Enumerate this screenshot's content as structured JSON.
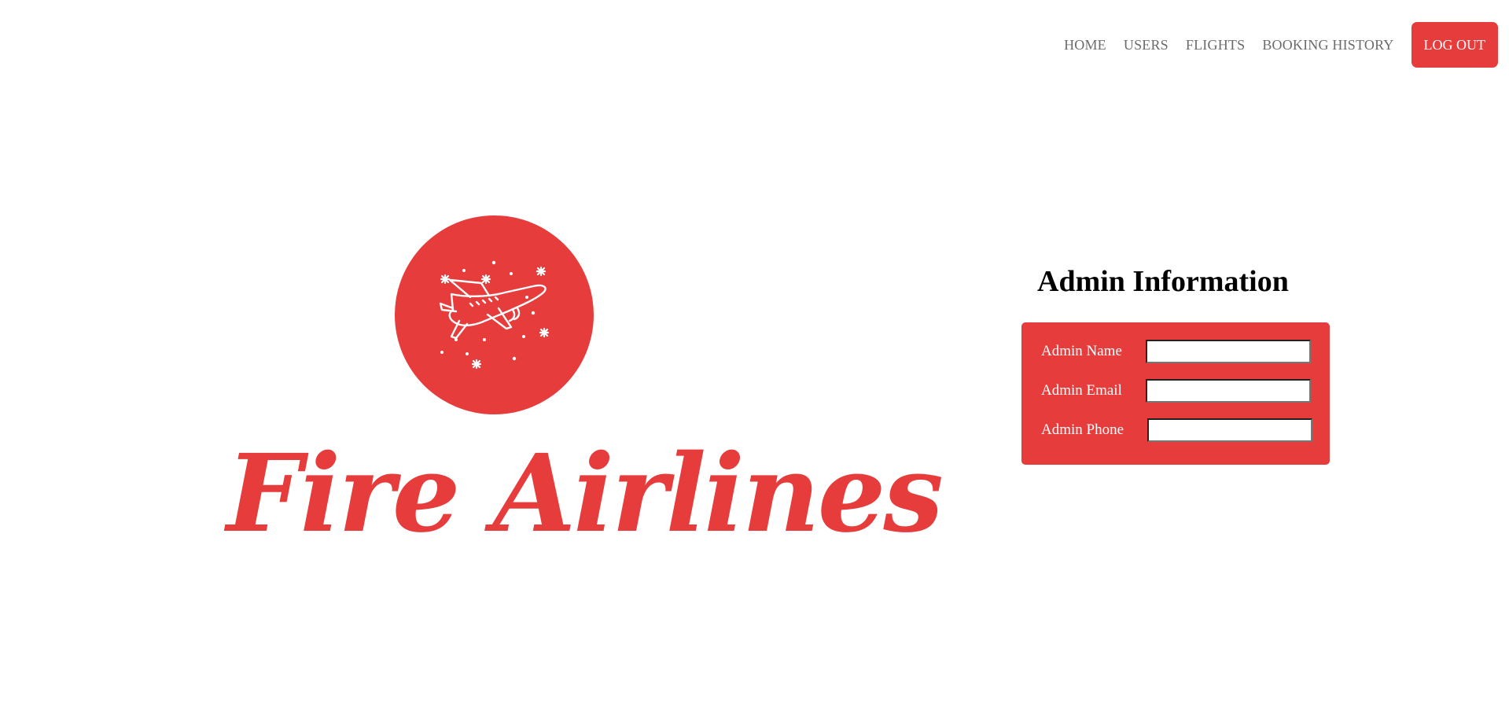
{
  "nav": {
    "items": [
      {
        "label": "HOME"
      },
      {
        "label": "USERS"
      },
      {
        "label": "FLIGHTS"
      },
      {
        "label": "BOOKING HISTORY"
      }
    ],
    "logout_label": "LOG OUT"
  },
  "brand": {
    "name": "Fire Airlines",
    "logo_icon": "airplane-icon",
    "color": "#e73c3c"
  },
  "admin": {
    "title": "Admin Information",
    "fields": [
      {
        "label": "Admin Name",
        "value": ""
      },
      {
        "label": "Admin Email",
        "value": ""
      },
      {
        "label": "Admin Phone",
        "value": ""
      }
    ]
  }
}
